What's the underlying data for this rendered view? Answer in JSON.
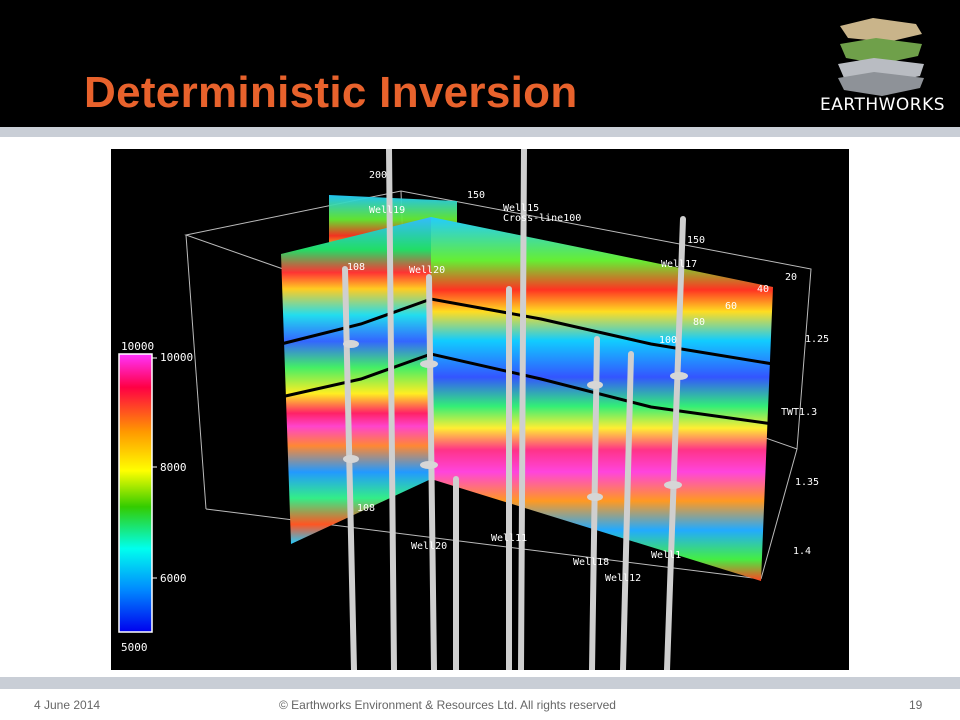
{
  "slide": {
    "title": "Deterministic Inversion",
    "logo_text": "EARTHWORKS",
    "footer": {
      "date": "4 June 2014",
      "copyright": "© Earthworks Environment & Resources Ltd.  All rights reserved",
      "page_number": "19"
    }
  },
  "colorbar": {
    "max_label": "10000",
    "min_label": "5000",
    "ticks": [
      "10000",
      "8000",
      "6000"
    ]
  },
  "twt_axis": [
    "1.25",
    "TWT1.3",
    "1.35",
    "1.4"
  ],
  "wells": {
    "well_19": "Well19",
    "well_15": "Well15",
    "well_17": "Well17",
    "well_20_top": "Well20",
    "well_20_bottom": "Well20",
    "well_11": "Well11",
    "well_18": "Well18",
    "well_12": "Well12",
    "well_right_bottom": "Well1"
  },
  "grid_labels": {
    "l200": "200",
    "l150a": "150",
    "crossline": "Cross-line100",
    "l150b": "150",
    "l108a": "108",
    "l108b": "108",
    "l20": "20",
    "l40": "40",
    "l60": "60",
    "l80": "80",
    "l100": "100"
  },
  "colors": {
    "title_orange": "#e8622c",
    "band_grey": "#c9ced6"
  }
}
